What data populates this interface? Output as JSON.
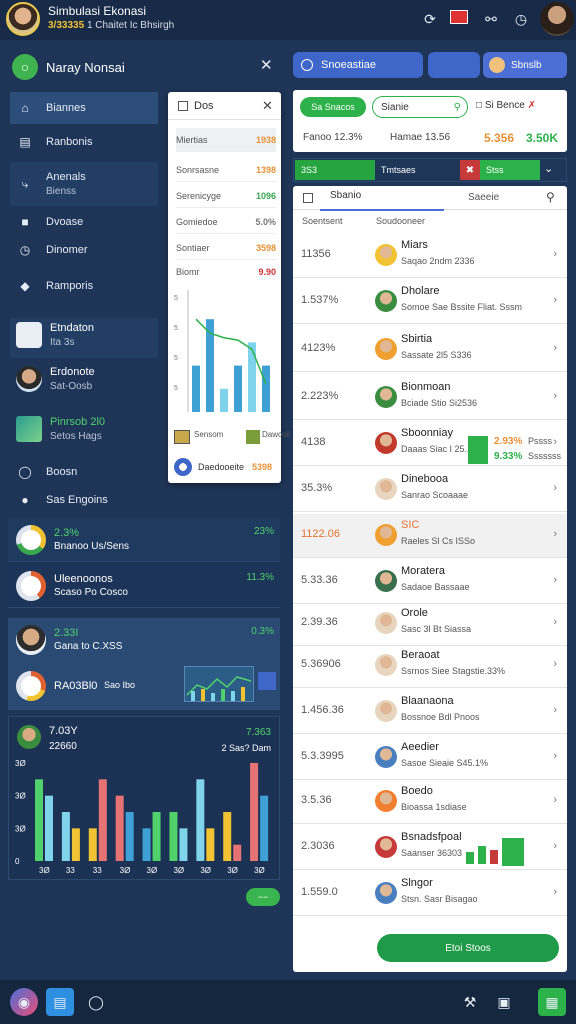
{
  "header": {
    "title": "Simbulasi Ekonasi",
    "subtitle_num": "3/33335",
    "subtitle_rest": "1 Chaitet Ic Bhsirgh",
    "icons": [
      "spinner-icon",
      "flag-icon",
      "globe-icon",
      "clock-icon"
    ]
  },
  "sidebar": {
    "title": "Naray Nonsai",
    "nav": [
      {
        "label": "Biannes",
        "icon": "home-icon"
      },
      {
        "label": "Ranbonis",
        "icon": "chart-icon"
      },
      {
        "label": "Anenals",
        "sub": "Bienss",
        "icon": "run-icon"
      },
      {
        "label": "Dvoase",
        "icon": "square-icon"
      },
      {
        "label": "Dinomer",
        "icon": "clock-icon"
      },
      {
        "label": "Ramporis",
        "icon": "tag-icon"
      }
    ],
    "people": [
      {
        "name": "Etndaton",
        "meta": "Ita 3s"
      },
      {
        "name": "Erdonote",
        "meta": "Sat-Oosb"
      },
      {
        "name": "Pinrsob 2l0",
        "meta": "Setos Hags"
      }
    ],
    "misc": [
      {
        "label": "Boosn"
      },
      {
        "label": "Sas Engoins"
      }
    ],
    "green_pill": "−−"
  },
  "popup": {
    "title": "Dos",
    "rows": [
      {
        "label": "Miertias",
        "value": "1938"
      },
      {
        "label": "Sonrsasne",
        "value": "1398"
      },
      {
        "label": "Serenicyge",
        "value": "1096"
      },
      {
        "label": "Gomiedoe",
        "value": "5.0%"
      },
      {
        "label": "Sontiaer",
        "value": "3598"
      },
      {
        "label": "Biomr",
        "value": "9.90"
      }
    ],
    "footer_label": "Daedooeite",
    "footer_value": "5398",
    "mini1": "Sensom",
    "mini2": "Dawcoil"
  },
  "left_rows": [
    {
      "title": "2.3%",
      "sub": "Bnanoo Us/Sens",
      "right": "23%"
    },
    {
      "title": "Uleenoonos",
      "sub": "Scaso Po Cosco",
      "right": "11.3%"
    },
    {
      "title": "2.33I",
      "sub": "Gana to C.XSS",
      "right": "0.3%"
    },
    {
      "title": "RA03Bl0",
      "sub": "Sao Ibo",
      "right": ""
    }
  ],
  "left_chart": {
    "title": "7.03Y",
    "sub": "22660",
    "right_top": "7.363",
    "right_sub": "2 Sas? Dam"
  },
  "chart_data": {
    "type": "bar",
    "categories": [
      "3Ø",
      "33",
      "33",
      "3Ø",
      "3Ø",
      "3Ø",
      "3Ø",
      "3Ø",
      "3Ø"
    ],
    "series": [
      {
        "values": [
          5,
          3,
          2,
          4,
          2,
          3,
          5,
          3,
          6
        ]
      },
      {
        "values": [
          4,
          2,
          5,
          3,
          3,
          2,
          2,
          1,
          4
        ]
      }
    ],
    "yticks": [
      "3Ø",
      "3Ø",
      "3Ø",
      "0"
    ]
  },
  "popup_chart": {
    "type": "bar",
    "values": [
      2,
      4,
      1,
      2,
      3,
      2
    ],
    "line": [
      4,
      3.4,
      3.2,
      3.1,
      2.7,
      1.2
    ],
    "yticks": [
      "5",
      "5",
      "5",
      "5"
    ]
  },
  "right": {
    "tab1": "Snoeastiae",
    "tab3": "Sbnslb",
    "green_button": "Sa Snacos",
    "search_value": "Sianie",
    "sum_right": "Si Bence",
    "stats": [
      {
        "label": "Fanoo",
        "value": "12.3%"
      },
      {
        "label": "Hamae",
        "value": "13.56"
      },
      {
        "label": "",
        "value": "5.356"
      },
      {
        "label": "",
        "value": "3.50K"
      }
    ],
    "progress": {
      "left": "3S3",
      "mid": "Tmtsaes",
      "right": "Stss"
    },
    "list_tabs": {
      "a": "Sbanio",
      "b": "Saeeie"
    },
    "col_headers": {
      "a": "Soentsent",
      "b": "Soudooneer"
    },
    "items": [
      {
        "pct": "11356",
        "name": "Miars",
        "sub": "Saqao 2ndm 2336",
        "highlight": false
      },
      {
        "pct": "1.537%",
        "name": "Dholare",
        "sub": "Somoe Sae Bssite Fliat. Sssm",
        "highlight": false
      },
      {
        "pct": "4123%",
        "name": "Sbirtia",
        "sub": "Sassate 2l5 S336",
        "highlight": false
      },
      {
        "pct": "2.223%",
        "name": "Bionmoan",
        "sub": "Bciade Stio Si2536",
        "highlight": false
      },
      {
        "pct": "4138",
        "name": "Sboonniay",
        "sub": "Daaas Siac I 25.1",
        "highlight": false
      },
      {
        "pct": "35.3%",
        "name": "Dinebooa",
        "sub": "Sanrao Scoaaae",
        "highlight": false
      },
      {
        "pct": "1122.06",
        "name": "SIC",
        "sub": "Raeles Sl Cs ISSo",
        "highlight": true
      },
      {
        "pct": "5.33.36",
        "name": "Moratera",
        "sub": "Sadaoe Bassaae",
        "highlight": false
      },
      {
        "pct": "2.39.36",
        "name": "Orole",
        "sub": "Sasc 3l Bt Siassa",
        "highlight": false
      },
      {
        "pct": "5.36906",
        "name": "Beraoat",
        "sub": "Ssrnos Siee Stagstie.33%",
        "highlight": false
      },
      {
        "pct": "1.456.36",
        "name": "Blaanaona",
        "sub": "Bossnoe Bdl Pnoos",
        "highlight": false
      },
      {
        "pct": "5.3.3995",
        "name": "Aeedier",
        "sub": "Sasoe Sieaie S45.1%",
        "highlight": false
      },
      {
        "pct": "3.5.36",
        "name": "Boedo",
        "sub": "Bioassa 1sdiase",
        "highlight": false
      },
      {
        "pct": "2.3036",
        "name": "Bsnadsfpoal",
        "sub": "Saanser 36303",
        "highlight": false
      },
      {
        "pct": "1.559.0",
        "name": "Slngor",
        "sub": "Stsn. Sasr Bisagao",
        "highlight": false
      }
    ],
    "item_stat": {
      "a": "2.93%",
      "b": "9.33%",
      "c": "Pssss",
      "d": "Sssssss"
    },
    "cta": "Etoi Stoos"
  },
  "colors": {
    "accent_blue": "#3f66c9",
    "accent_green": "#2db14a",
    "bg": "#1f3557"
  },
  "bottom": {
    "icons": [
      "app-icon",
      "folder-icon",
      "circle-icon",
      "tools-icon",
      "screen-icon",
      "grid-icon"
    ]
  }
}
